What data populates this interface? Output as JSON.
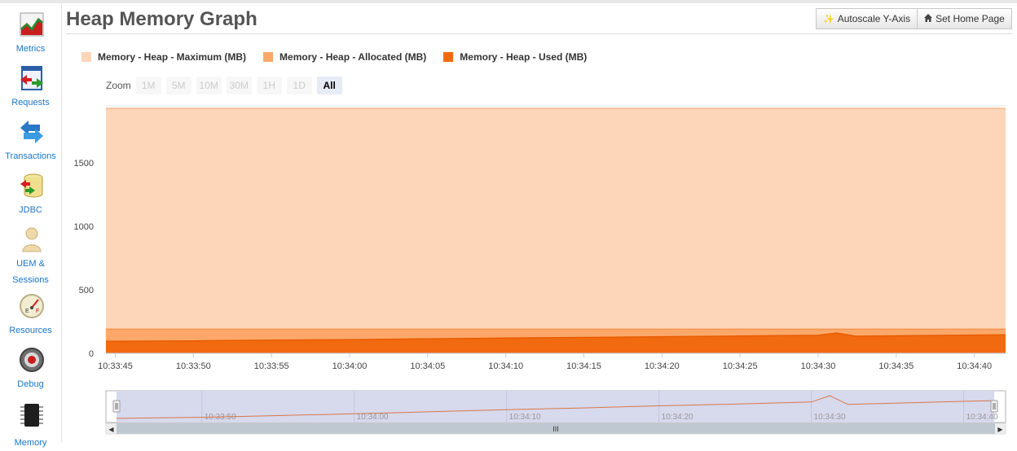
{
  "sidebar": {
    "items": [
      {
        "label": "Metrics",
        "icon": "metrics-chart-icon"
      },
      {
        "label": "Requests",
        "icon": "requests-icon"
      },
      {
        "label": "Transactions",
        "icon": "transactions-arrows-icon"
      },
      {
        "label": "JDBC",
        "icon": "database-icon"
      },
      {
        "label_line1": "UEM &",
        "label_line2": "Sessions",
        "icon": "user-icon"
      },
      {
        "label": "Resources",
        "icon": "gauge-icon",
        "active": true
      },
      {
        "label": "Debug",
        "icon": "debug-icon"
      },
      {
        "label": "Memory",
        "icon": "memory-chip-icon"
      }
    ]
  },
  "header": {
    "title": "Heap Memory Graph",
    "autoscale_label": "Autoscale Y-Axis",
    "home_label": "Set Home Page"
  },
  "legend": [
    {
      "label": "Memory - Heap - Maximum (MB)",
      "color": "#fdd5b8"
    },
    {
      "label": "Memory - Heap - Allocated (MB)",
      "color": "#fba86a"
    },
    {
      "label": "Memory - Heap - Used (MB)",
      "color": "#f26a10"
    }
  ],
  "zoom": {
    "label": "Zoom",
    "buttons": [
      "1M",
      "5M",
      "10M",
      "30M",
      "1H",
      "1D",
      "All"
    ],
    "selected": "All"
  },
  "chart_data": {
    "type": "area",
    "title": "Heap Memory Graph",
    "xlabel": "",
    "ylabel": "",
    "ylim": [
      0,
      1950
    ],
    "yticks": [
      0,
      500,
      1000,
      1500
    ],
    "xticks": [
      "10:33:45",
      "10:33:50",
      "10:33:55",
      "10:34:00",
      "10:34:05",
      "10:34:10",
      "10:34:15",
      "10:34:20",
      "10:34:25",
      "10:34:30",
      "10:34:35",
      "10:34:40"
    ],
    "x_range": [
      "10:33:44.4",
      "10:34:42.0"
    ],
    "grid": true,
    "legend_position": "top-left",
    "series": [
      {
        "name": "Memory - Heap - Maximum (MB)",
        "color": "#fdd5b8",
        "points": [
          [
            "10:33:44.4",
            1930
          ],
          [
            "10:34:42.0",
            1930
          ]
        ]
      },
      {
        "name": "Memory - Heap - Allocated (MB)",
        "color": "#fba86a",
        "points": [
          [
            "10:33:44.4",
            190
          ],
          [
            "10:34:42.0",
            190
          ]
        ]
      },
      {
        "name": "Memory - Heap - Used (MB)",
        "color": "#f26a10",
        "points": [
          [
            "10:33:44.4",
            95
          ],
          [
            "10:33:50",
            98
          ],
          [
            "10:33:55",
            103
          ],
          [
            "10:34:00",
            108
          ],
          [
            "10:34:05",
            114
          ],
          [
            "10:34:10",
            120
          ],
          [
            "10:34:15",
            125
          ],
          [
            "10:34:20",
            131
          ],
          [
            "10:34:25",
            136
          ],
          [
            "10:34:30",
            142
          ],
          [
            "10:34:31.2",
            160
          ],
          [
            "10:34:32.4",
            135
          ],
          [
            "10:34:35",
            138
          ],
          [
            "10:34:40",
            144
          ],
          [
            "10:34:42.0",
            146
          ]
        ]
      }
    ]
  },
  "navigator": {
    "ticks": [
      "10:33:50",
      "10:34:00",
      "10:34:10",
      "10:34:20",
      "10:34:30",
      "10:34:40"
    ],
    "scroll_grip": "III",
    "left_arrow": "◀",
    "right_arrow": "▶"
  }
}
